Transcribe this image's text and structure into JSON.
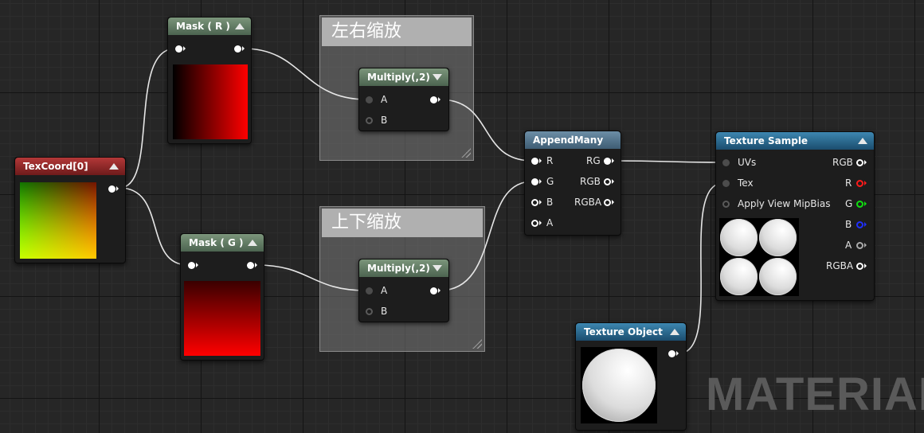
{
  "comments": [
    {
      "title": "左右缩放"
    },
    {
      "title": "上下缩放"
    }
  ],
  "nodes": {
    "texcoord": {
      "title": "TexCoord[0]"
    },
    "mask_r": {
      "title": "Mask ( R )"
    },
    "mask_g": {
      "title": "Mask ( G )"
    },
    "multiply_1": {
      "title": "Multiply(,2)",
      "inputs": [
        "A",
        "B"
      ]
    },
    "multiply_2": {
      "title": "Multiply(,2)",
      "inputs": [
        "A",
        "B"
      ]
    },
    "append_many": {
      "title": "AppendMany",
      "inputs": [
        "R",
        "G",
        "B",
        "A"
      ],
      "outputs": [
        "RG",
        "RGB",
        "RGBA"
      ]
    },
    "texture_sample": {
      "title": "Texture Sample",
      "inputs": [
        "UVs",
        "Tex",
        "Apply View MipBias"
      ],
      "outputs": [
        "RGB",
        "R",
        "G",
        "B",
        "A",
        "RGBA"
      ]
    },
    "texture_object": {
      "title": "Texture Object"
    }
  },
  "watermark": "MATERIAL",
  "colors": {
    "header_green": "#5a735c",
    "header_red": "#8a2222",
    "header_blue": "#2a6a90",
    "pin_r": "#ff1a1a",
    "pin_g": "#10e010",
    "pin_b": "#2030ff"
  }
}
